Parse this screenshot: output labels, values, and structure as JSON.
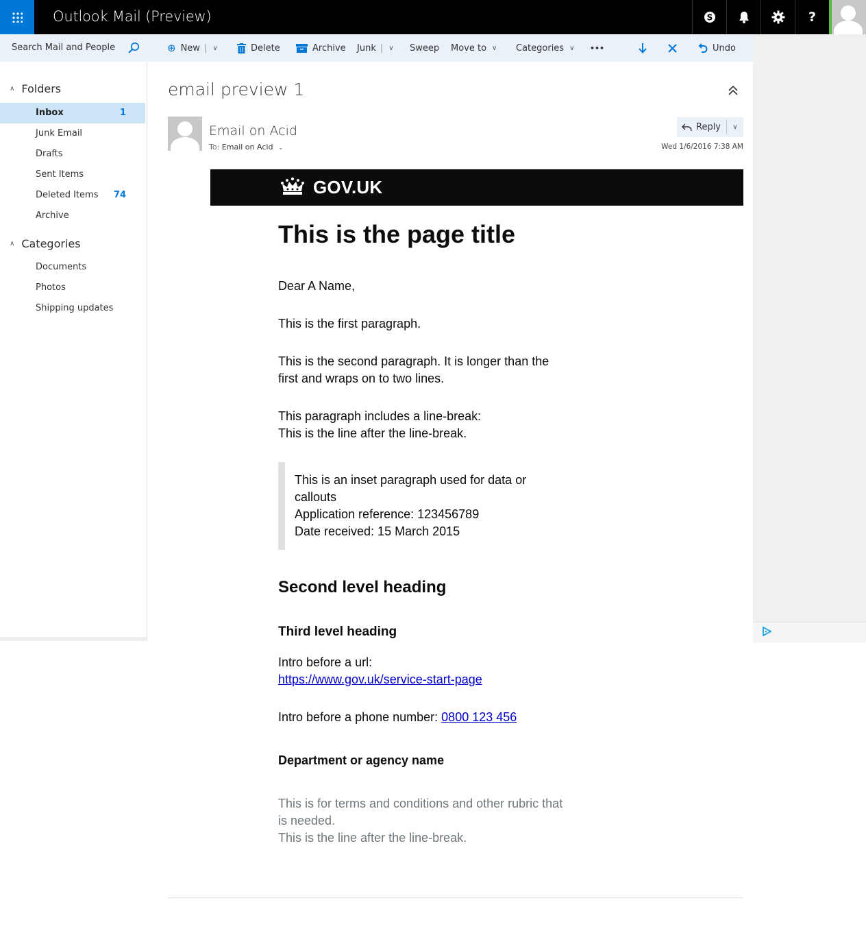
{
  "app": {
    "title": "Outlook Mail (Preview)"
  },
  "topbar": {
    "icons": [
      "app-launcher-icon",
      "skype-icon",
      "bell-icon",
      "gear-icon",
      "help-icon",
      "user-avatar"
    ],
    "accent": "#0078d7"
  },
  "search": {
    "placeholder": "Search Mail and People"
  },
  "toolbar": {
    "new_label": "New",
    "delete_label": "Delete",
    "archive_label": "Archive",
    "junk_label": "Junk",
    "sweep_label": "Sweep",
    "moveto_label": "Move to",
    "categories_label": "Categories",
    "more_label": "•••",
    "undo_label": "Undo"
  },
  "sidebar": {
    "folders_heading": "Folders",
    "folders": [
      {
        "label": "Inbox",
        "count": "1"
      },
      {
        "label": "Junk Email",
        "count": ""
      },
      {
        "label": "Drafts",
        "count": ""
      },
      {
        "label": "Sent Items",
        "count": ""
      },
      {
        "label": "Deleted Items",
        "count": "74"
      },
      {
        "label": "Archive",
        "count": ""
      }
    ],
    "categories_heading": "Categories",
    "categories": [
      {
        "label": "Documents"
      },
      {
        "label": "Photos"
      },
      {
        "label": "Shipping updates"
      }
    ]
  },
  "message": {
    "subject": "email preview 1",
    "sender": "Email on Acid",
    "to_prefix": "To:",
    "to_name": "Email on Acid",
    "reply_label": "Reply",
    "date": "Wed 1/6/2016 7:38 AM"
  },
  "email": {
    "brand": "GOV.UK",
    "title": "This is the page title",
    "greeting": "Dear A Name,",
    "para1": "This is the first paragraph.",
    "para2_line1": "This is the second paragraph. It is longer than the",
    "para2_line2": "first and wraps on to two lines.",
    "para3_line1": "This paragraph includes a line-break:",
    "para3_line2": "This is the line after the line-break.",
    "inset_line1": "This is an inset paragraph used for data or",
    "inset_line2": "callouts",
    "inset_line3": "Application reference: 123456789",
    "inset_line4": "Date received: 15 March 2015",
    "h2": "Second level heading",
    "h3": "Third level heading",
    "url_intro": "Intro before a url:",
    "url": "https://www.gov.uk/service-start-page",
    "phone_intro": "Intro before a phone number: ",
    "phone": "0800 123 456",
    "dept": "Department or agency name",
    "terms_line1": "This is for terms and conditions and other rubric that",
    "terms_line2": "is needed.",
    "terms_line3": "This is the line after the line-break."
  }
}
